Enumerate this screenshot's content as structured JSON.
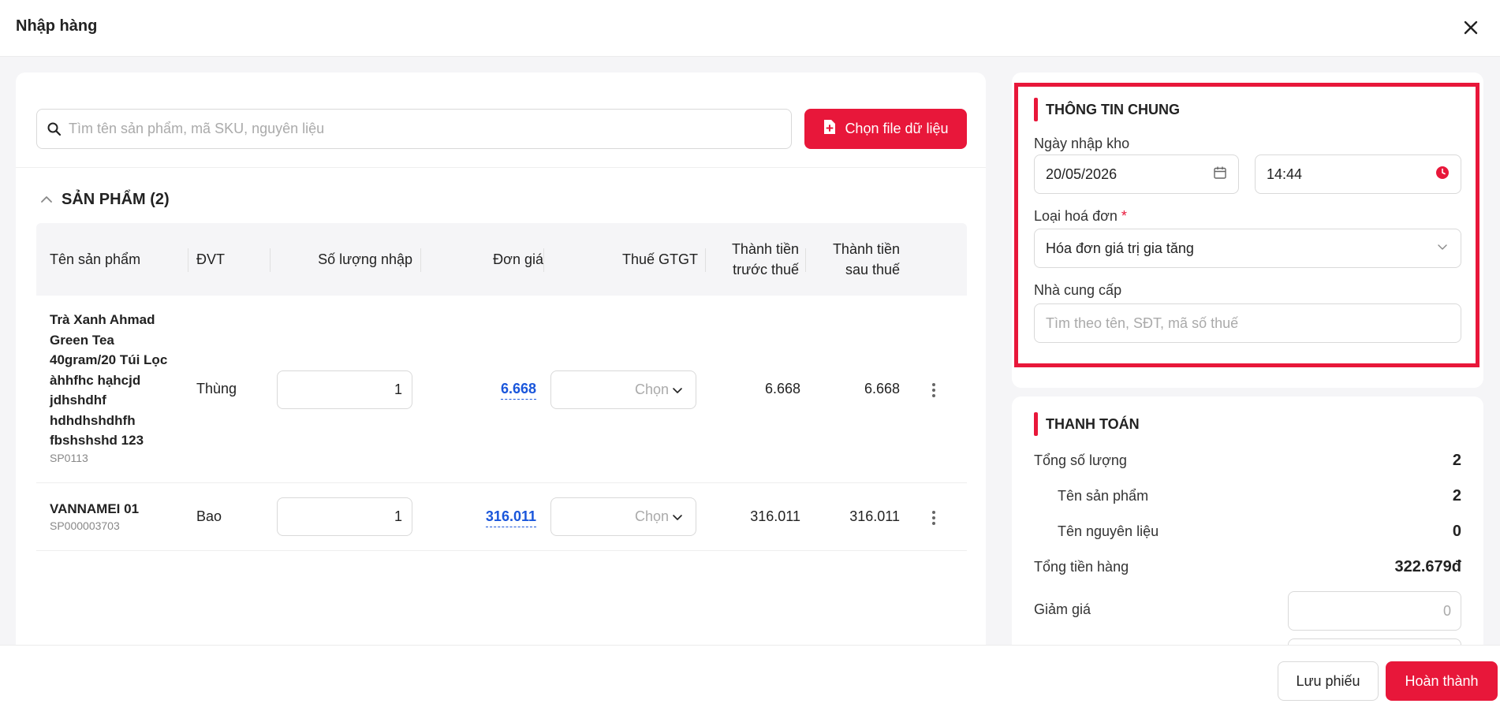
{
  "header": {
    "title": "Nhập hàng"
  },
  "search": {
    "placeholder": "Tìm tên sản phẩm, mã SKU, nguyên liệu"
  },
  "file_button": {
    "label": "Chọn file dữ liệu"
  },
  "products": {
    "title": "SẢN PHẨM (2)",
    "columns": {
      "name": "Tên sản phẩm",
      "unit": "ĐVT",
      "qty": "Số lượng nhập",
      "price": "Đơn giá",
      "tax": "Thuế GTGT",
      "pre_tax_1": "Thành tiền",
      "pre_tax_2": "trước thuế",
      "post_tax_1": "Thành tiền",
      "post_tax_2": "sau thuế"
    },
    "rows": [
      {
        "name": "Trà Xanh Ahmad Green Tea 40gram/20 Túi Lọc àhhfhc hạhcjd jdhshdhf hdhdhshdhfh fbshshshd 123",
        "sku": "SP0113",
        "unit": "Thùng",
        "qty": "1",
        "price": "6.668",
        "tax": "Chọn",
        "pre_tax": "6.668",
        "post_tax": "6.668"
      },
      {
        "name": "VANNAMEI 01",
        "sku": "SP000003703",
        "unit": "Bao",
        "qty": "1",
        "price": "316.011",
        "tax": "Chọn",
        "pre_tax": "316.011",
        "post_tax": "316.011"
      }
    ]
  },
  "general": {
    "title": "THÔNG TIN CHUNG",
    "date_label": "Ngày nhập kho",
    "date_value": "20/05/2026",
    "time_value": "14:44",
    "invoice_label": "Loại hoá đơn",
    "invoice_required": "*",
    "invoice_value": "Hóa đơn giá trị gia tăng",
    "supplier_label": "Nhà cung cấp",
    "supplier_placeholder": "Tìm theo tên, SĐT, mã số thuế"
  },
  "payment": {
    "title": "THANH TOÁN",
    "total_qty_label": "Tổng số lượng",
    "total_qty": "2",
    "product_label": "Tên sản phẩm",
    "product_count": "2",
    "material_label": "Tên nguyên liệu",
    "material_count": "0",
    "total_amount_label": "Tổng tiền hàng",
    "total_amount": "322.679đ",
    "discount_label": "Giảm giá",
    "discount_value": "0"
  },
  "footer": {
    "save_label": "Lưu phiếu",
    "done_label": "Hoàn thành"
  },
  "colors": {
    "accent": "#e8173a",
    "link": "#1a56db"
  }
}
